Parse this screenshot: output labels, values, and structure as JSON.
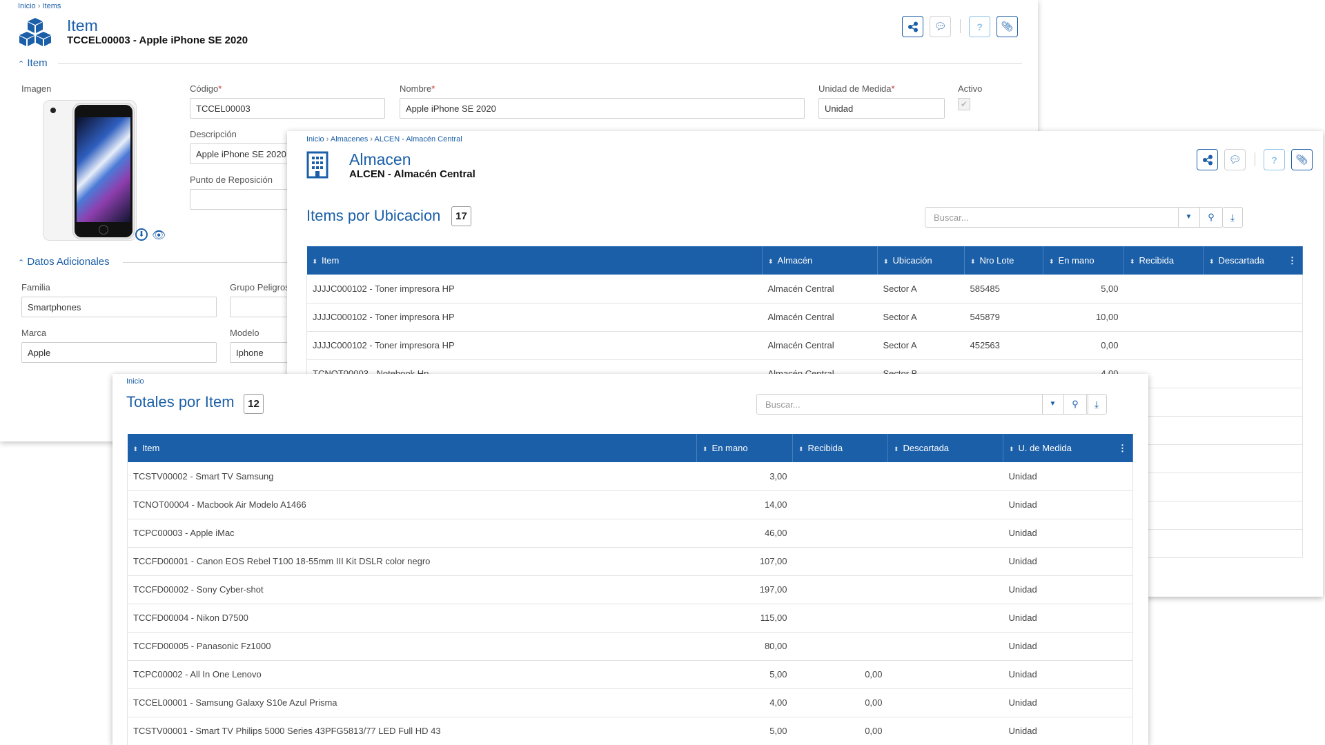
{
  "item_panel": {
    "breadcrumb": [
      "Inicio",
      "Items"
    ],
    "title": "Item",
    "subtitle": "TCCEL00003 - Apple iPhone SE 2020",
    "section_item": "Item",
    "labels": {
      "imagen": "Imagen",
      "codigo": "Código",
      "nombre": "Nombre",
      "unidad": "Unidad de Medida",
      "activo": "Activo",
      "descripcion": "Descripción",
      "punto_reposicion": "Punto de Reposición",
      "familia": "Familia",
      "grupo_peligro": "Grupo Peligros",
      "marca": "Marca",
      "modelo": "Modelo"
    },
    "values": {
      "codigo": "TCCEL00003",
      "nombre": "Apple iPhone SE 2020",
      "unidad": "Unidad",
      "descripcion": "Apple iPhone SE 2020",
      "punto_reposicion": "",
      "familia": "Smartphones",
      "grupo_peligro": "",
      "marca": "Apple",
      "modelo": "Iphone"
    },
    "activo_checked": true,
    "section_adicionales": "Datos Adicionales"
  },
  "almacen_panel": {
    "breadcrumb": [
      "Inicio",
      "Almacenes",
      "ALCEN - Almacén Central"
    ],
    "title": "Almacen",
    "subtitle": "ALCEN - Almacén Central",
    "list_title": "Items por Ubicacion",
    "count": "17",
    "search_placeholder": "Buscar...",
    "columns": [
      "Item",
      "Almacén",
      "Ubicación",
      "Nro Lote",
      "En mano",
      "Recibida",
      "Descartada"
    ],
    "rows": [
      [
        "JJJJC000102 - Toner impresora HP",
        "Almacén Central",
        "Sector A",
        "585485",
        "5,00",
        "",
        ""
      ],
      [
        "JJJJC000102 - Toner impresora HP",
        "Almacén Central",
        "Sector A",
        "545879",
        "10,00",
        "",
        ""
      ],
      [
        "JJJJC000102 - Toner impresora HP",
        "Almacén Central",
        "Sector A",
        "452563",
        "0,00",
        "",
        ""
      ],
      [
        "TCNOT00003 - Notebook Hp",
        "Almacén Central",
        "Sector B",
        "",
        "4,00",
        "",
        ""
      ]
    ]
  },
  "totales_panel": {
    "breadcrumb": [
      "Inicio"
    ],
    "list_title": "Totales por Item",
    "count": "12",
    "search_placeholder": "Buscar...",
    "columns": [
      "Item",
      "En mano",
      "Recibida",
      "Descartada",
      "U. de Medida"
    ],
    "rows": [
      [
        "TCSTV00002 - Smart TV Samsung",
        "3,00",
        "",
        "",
        "Unidad"
      ],
      [
        "TCNOT00004 - Macbook Air Modelo A1466",
        "14,00",
        "",
        "",
        "Unidad"
      ],
      [
        "TCPC00003 - Apple iMac",
        "46,00",
        "",
        "",
        "Unidad"
      ],
      [
        "TCCFD00001 - Canon EOS Rebel T100 18-55mm III Kit DSLR color negro",
        "107,00",
        "",
        "",
        "Unidad"
      ],
      [
        "TCCFD00002 - Sony Cyber-shot",
        "197,00",
        "",
        "",
        "Unidad"
      ],
      [
        "TCCFD00004 - Nikon D7500",
        "115,00",
        "",
        "",
        "Unidad"
      ],
      [
        "TCCFD00005 - Panasonic Fz1000",
        "80,00",
        "",
        "",
        "Unidad"
      ],
      [
        "TCPC00002 - All In One Lenovo",
        "5,00",
        "0,00",
        "",
        "Unidad"
      ],
      [
        "TCCEL00001 - Samsung Galaxy S10e Azul Prisma",
        "4,00",
        "0,00",
        "",
        "Unidad"
      ],
      [
        "TCSTV00001 - Smart TV Philips 5000 Series 43PFG5813/77 LED Full HD 43",
        "5,00",
        "0,00",
        "",
        "Unidad"
      ]
    ]
  },
  "icons": [
    "share-icon",
    "comment-icon",
    "help-icon",
    "attachment-icon",
    "cubes-icon",
    "building-icon",
    "download-icon",
    "eye-icon",
    "search-icon"
  ]
}
